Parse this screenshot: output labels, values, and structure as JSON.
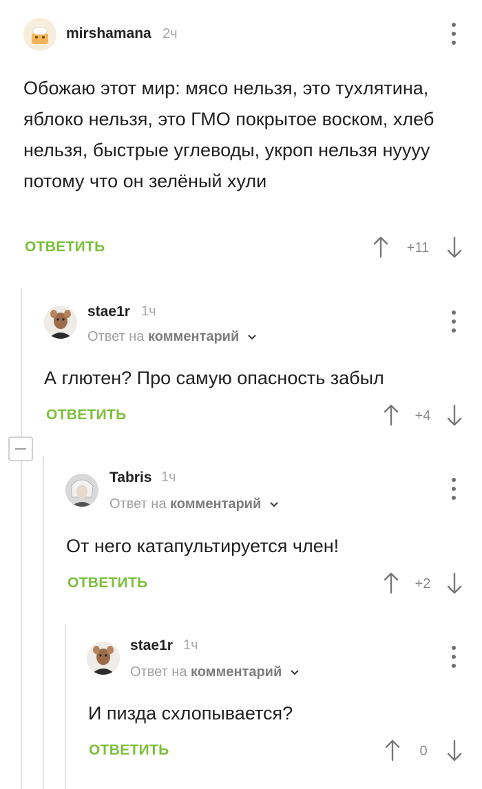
{
  "comments": [
    {
      "username": "mirshamana",
      "time": "2ч",
      "text": "Обожаю этот мир: мясо нельзя, это тухлятина, яблоко нельзя, это ГМО покрытое воском, хлеб нельзя, быстрые углеводы, укроп нельзя нуууу потому что он зелёный хули",
      "reply_label": "ОТВЕТИТЬ",
      "rating": "+11"
    },
    {
      "username": "stae1r",
      "time": "1ч",
      "reply_to_prefix": "Ответ на",
      "reply_to_target": "комментарий",
      "text": "А глютен? Про самую опасность забыл",
      "reply_label": "ОТВЕТИТЬ",
      "rating": "+4"
    },
    {
      "username": "Tabris",
      "time": "1ч",
      "reply_to_prefix": "Ответ на",
      "reply_to_target": "комментарий",
      "text": "От него катапультируется член!",
      "reply_label": "ОТВЕТИТЬ",
      "rating": "+2"
    },
    {
      "username": "stae1r",
      "time": "1ч",
      "reply_to_prefix": "Ответ на",
      "reply_to_target": "комментарий",
      "text": "И пизда схлопывается?",
      "reply_label": "ОТВЕТИТЬ",
      "rating": "0"
    }
  ],
  "colors": {
    "accent": "#7cbf3a",
    "thread_line": "#e3e3e3",
    "muted_text": "#a8a8a8"
  }
}
